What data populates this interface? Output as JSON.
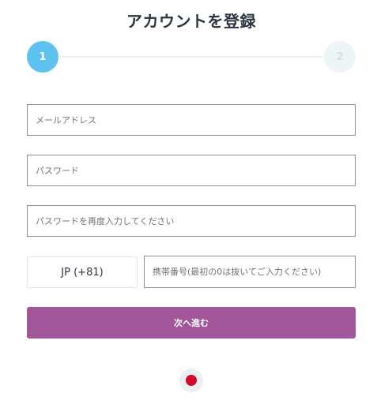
{
  "title": "アカウントを登録",
  "stepper": {
    "steps": [
      "1",
      "2"
    ],
    "active_step": 1
  },
  "form": {
    "email_placeholder": "メールアドレス",
    "password_placeholder": "パスワード",
    "password_confirm_placeholder": "パスワードを再度入力してください",
    "country_code": "JP (+81)",
    "phone_placeholder": "携帯番号(最初の0は抜いてご入力ください)",
    "next_label": "次へ進む"
  },
  "language": {
    "current": "Japanese",
    "flag_icon": "japan-flag-icon"
  },
  "colors": {
    "accent": "#a2569a",
    "step_active": "#5ec2ee",
    "step_inactive": "#eef5f6",
    "flag_red": "#d40a2a"
  }
}
